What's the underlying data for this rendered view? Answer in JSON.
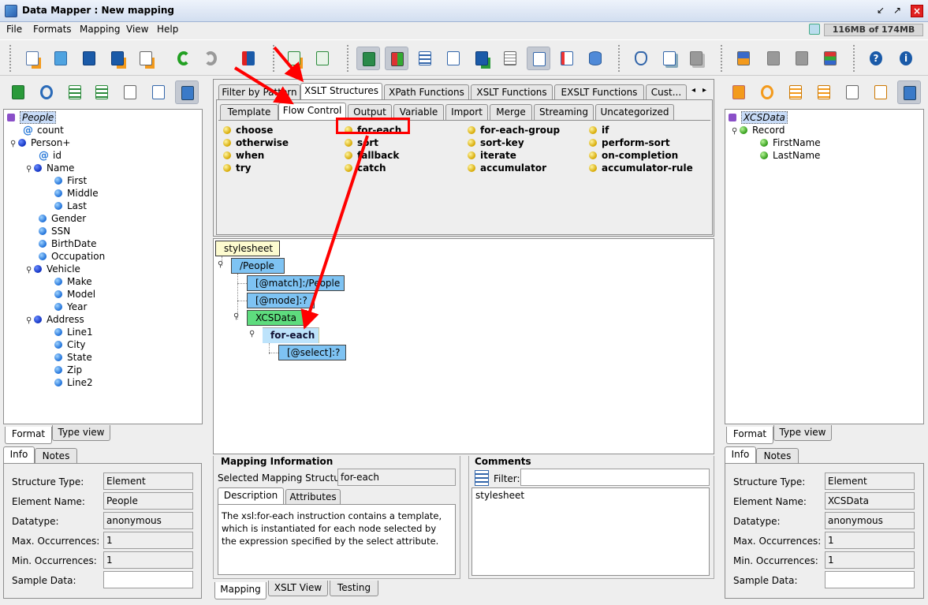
{
  "window": {
    "title": "Data Mapper : New mapping",
    "memory": "116MB of 174MB"
  },
  "menus": [
    "File",
    "Formats",
    "Mapping",
    "View",
    "Help"
  ],
  "left_tree": {
    "root": "People",
    "rows": [
      {
        "label": "People",
        "kind": "root"
      },
      {
        "label": "count",
        "kind": "attr"
      },
      {
        "label": "Person+",
        "kind": "elem"
      },
      {
        "label": "id",
        "kind": "attr"
      },
      {
        "label": "Name",
        "kind": "elem"
      },
      {
        "label": "First",
        "kind": "leaf"
      },
      {
        "label": "Middle",
        "kind": "leaf"
      },
      {
        "label": "Last",
        "kind": "leaf"
      },
      {
        "label": "Gender",
        "kind": "leaf"
      },
      {
        "label": "SSN",
        "kind": "leaf"
      },
      {
        "label": "BirthDate",
        "kind": "leaf"
      },
      {
        "label": "Occupation",
        "kind": "leaf"
      },
      {
        "label": "Vehicle",
        "kind": "elem"
      },
      {
        "label": "Make",
        "kind": "leaf"
      },
      {
        "label": "Model",
        "kind": "leaf"
      },
      {
        "label": "Year",
        "kind": "leaf"
      },
      {
        "label": "Address",
        "kind": "elem"
      },
      {
        "label": "Line1",
        "kind": "leaf"
      },
      {
        "label": "City",
        "kind": "leaf"
      },
      {
        "label": "State",
        "kind": "leaf"
      },
      {
        "label": "Zip",
        "kind": "leaf"
      },
      {
        "label": "Line2",
        "kind": "leaf"
      }
    ]
  },
  "left_view_tabs": [
    "Format",
    "Type view"
  ],
  "left_info_tabs": [
    "Info",
    "Notes"
  ],
  "left_info": {
    "labels": [
      "Structure Type:",
      "Element Name:",
      "Datatype:",
      "Max. Occurrences:",
      "Min. Occurrences:",
      "Sample Data:"
    ],
    "values": [
      "Element",
      "People",
      "anonymous",
      "1",
      "1",
      ""
    ]
  },
  "right_tree": {
    "rows": [
      {
        "label": "XCSData",
        "kind": "root"
      },
      {
        "label": "Record",
        "kind": "elem"
      },
      {
        "label": "FirstName",
        "kind": "leaf"
      },
      {
        "label": "LastName",
        "kind": "leaf"
      }
    ]
  },
  "right_view_tabs": [
    "Format",
    "Type view"
  ],
  "right_info_tabs": [
    "Info",
    "Notes"
  ],
  "right_info": {
    "labels": [
      "Structure Type:",
      "Element Name:",
      "Datatype:",
      "Max. Occurrences:",
      "Min. Occurrences:",
      "Sample Data:"
    ],
    "values": [
      "Element",
      "XCSData",
      "anonymous",
      "1",
      "1",
      ""
    ]
  },
  "palette_tabs": [
    "Filter by Pattern",
    "XSLT Structures",
    "XPath Functions",
    "XSLT Functions",
    "EXSLT Functions",
    "Cust..."
  ],
  "palette_subtabs": [
    "Template",
    "Flow Control",
    "Output",
    "Variable",
    "Import",
    "Merge",
    "Streaming",
    "Uncategorized"
  ],
  "palette_items": [
    [
      "choose",
      "otherwise",
      "when",
      "try"
    ],
    [
      "for-each",
      "sort",
      "fallback",
      "catch"
    ],
    [
      "for-each-group",
      "sort-key",
      "iterate",
      "accumulator"
    ],
    [
      "if",
      "perform-sort",
      "on-completion",
      "accumulator-rule"
    ]
  ],
  "mapping_tree": {
    "nodes": [
      "stylesheet",
      "/People",
      "[@match]:/People",
      "[@mode]:?",
      "XCSData",
      "for-each",
      "[@select]:?"
    ]
  },
  "mapping_info": {
    "title": "Mapping Information",
    "selected_label": "Selected Mapping Structure:",
    "selected_value": "for-each",
    "tabs": [
      "Description",
      "Attributes"
    ],
    "description": "The xsl:for-each instruction contains a template, which is instantiated for each node selected by the expression specified by the select attribute."
  },
  "comments": {
    "title": "Comments",
    "filter_label": "Filter:",
    "filter_value": "",
    "items": [
      "stylesheet"
    ]
  },
  "bottom_tabs": [
    "Mapping",
    "XSLT View",
    "Testing"
  ],
  "accent": {
    "highlight": "#ff0000",
    "selection": "#c8dcf8"
  }
}
